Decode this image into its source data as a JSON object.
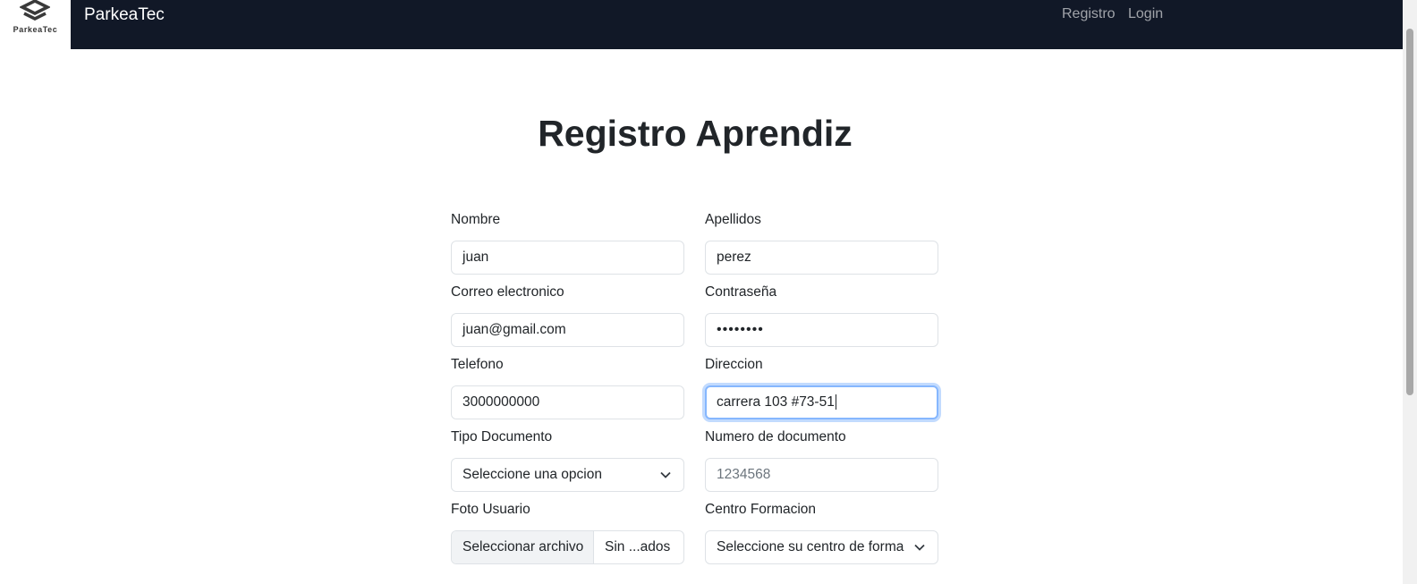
{
  "nav": {
    "logo_text": "ParkeaTec",
    "brand": "ParkeaTec",
    "links": {
      "registro": "Registro",
      "login": "Login"
    }
  },
  "page": {
    "title": "Registro Aprendiz"
  },
  "form": {
    "nombre": {
      "label": "Nombre",
      "value": "juan"
    },
    "apellidos": {
      "label": "Apellidos",
      "value": "perez"
    },
    "correo": {
      "label": "Correo electronico",
      "value": "juan@gmail.com"
    },
    "contrasena": {
      "label": "Contraseña",
      "value": "••••••••"
    },
    "telefono": {
      "label": "Telefono",
      "value": "3000000000"
    },
    "direccion": {
      "label": "Direccion",
      "value": "carrera 103 #73-51"
    },
    "tipo_documento": {
      "label": "Tipo Documento",
      "selected": "Seleccione una opcion"
    },
    "numero_documento": {
      "label": "Numero de documento",
      "placeholder": "1234568"
    },
    "foto_usuario": {
      "label": "Foto Usuario",
      "button": "Seleccionar archivo",
      "file_name": "Sin ...ados"
    },
    "centro_formacion": {
      "label": "Centro Formacion",
      "selected": "Seleccione su centro de forma"
    }
  },
  "colors": {
    "navbar": "#111827",
    "focus_border": "#86b7fe",
    "text": "#212529"
  }
}
